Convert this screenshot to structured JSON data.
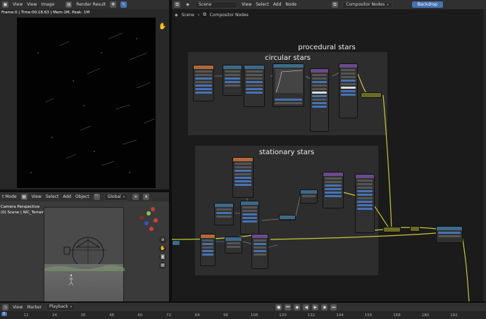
{
  "image_editor": {
    "menu": [
      "View",
      "View",
      "Image"
    ],
    "image_name": "Render Result",
    "frame_info": "Frame:0 | Time:00:18.63 | Mem:1M, Peak: 1M"
  },
  "viewport": {
    "menu": [
      "t Mode",
      "View",
      "Select",
      "Add",
      "Object"
    ],
    "transform": "Global",
    "info_line1": "Camera Perspective",
    "info_line2": "(0) Scene | WC_Terrain_0_0"
  },
  "node_editor": {
    "menu": [
      "View",
      "Select",
      "Add",
      "Node"
    ],
    "scene": "Scene",
    "tree": "Compositor Nodes",
    "backdrop": "Backdrop",
    "breadcrumb": [
      "Scene",
      "Compositor Nodes"
    ],
    "frames": {
      "procedural": "procedural stars",
      "circular": "circular stars",
      "stationary": "stationary stars"
    }
  },
  "timeline": {
    "playback": "Playback",
    "marker": "Marker",
    "view": "View",
    "current_frame": "0",
    "ticks": [
      "12",
      "24",
      "36",
      "48",
      "60",
      "72",
      "84",
      "96",
      "108",
      "120",
      "132",
      "144",
      "156",
      "168",
      "180",
      "192"
    ]
  },
  "colors": {
    "accent": "#4772b3",
    "link_yellow": "#c8c83a",
    "header": "#303030"
  }
}
